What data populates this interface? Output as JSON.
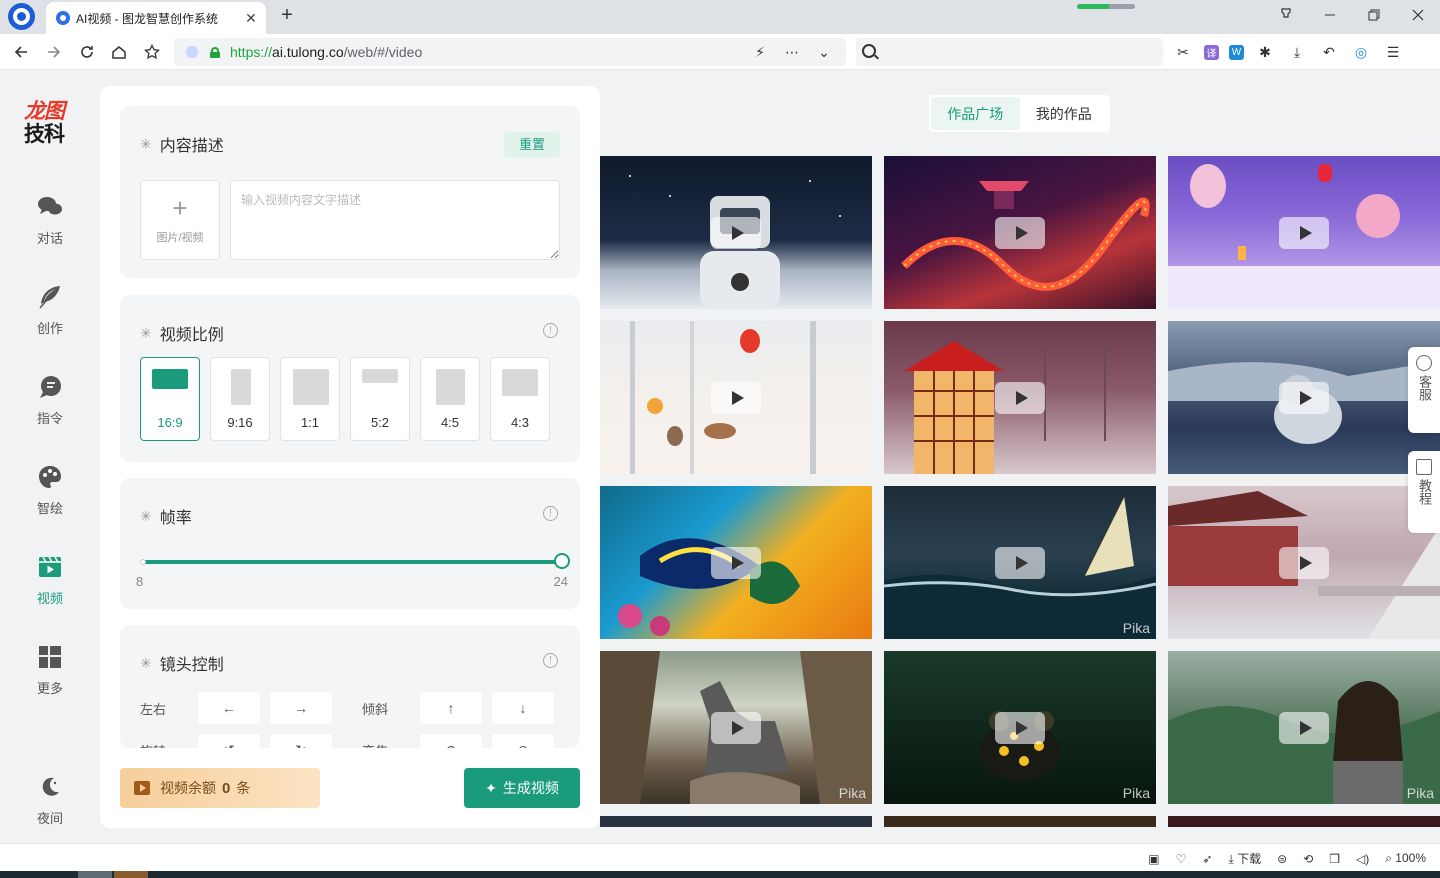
{
  "browser": {
    "tab_title": "AI视频 - 图龙智慧创作系统",
    "tab_close": "✕",
    "new_tab": "+",
    "loading_progress": 0.55,
    "url_scheme": "https://",
    "url_host": "ai.tulong.co",
    "url_path": "/web/#/video",
    "status_bar": {
      "download": "下载",
      "zoom": "100%"
    }
  },
  "sidebar": {
    "logo_line1": "龙图",
    "logo_line2": "技科",
    "items": [
      {
        "label": "对话",
        "icon": "chat-bubbles-icon"
      },
      {
        "label": "创作",
        "icon": "feather-icon"
      },
      {
        "label": "指令",
        "icon": "command-icon"
      },
      {
        "label": "智绘",
        "icon": "palette-icon"
      },
      {
        "label": "视频",
        "icon": "video-icon",
        "active": true
      },
      {
        "label": "更多",
        "icon": "grid-icon"
      }
    ],
    "night_label": "夜间"
  },
  "panel": {
    "content": {
      "title": "内容描述",
      "reset": "重置",
      "upload_label": "图片/视频",
      "desc_placeholder": "输入视频内容文字描述"
    },
    "ratio": {
      "title": "视频比例",
      "options": [
        "16:9",
        "9:16",
        "1:1",
        "5:2",
        "4:5",
        "4:3"
      ],
      "selected": "16:9"
    },
    "framerate": {
      "title": "帧率",
      "min": "8",
      "max": "24",
      "value": 24
    },
    "camera": {
      "title": "镜头控制",
      "row1": {
        "label_a": "左右",
        "label_b": "倾斜"
      },
      "row2": {
        "label_a": "旋转",
        "label_b": "变焦"
      }
    },
    "quota": {
      "label": "视频余额",
      "count": "0",
      "unit": "条"
    },
    "generate": "生成视频"
  },
  "gallery": {
    "tabs": [
      "作品广场",
      "我的作品"
    ],
    "active_tab": "作品广场",
    "watermark": "Pika"
  },
  "float": {
    "service": "客服",
    "tutorial": "教程"
  },
  "colors": {
    "accent": "#1a9b7b",
    "brand_red": "#e83a2c"
  }
}
